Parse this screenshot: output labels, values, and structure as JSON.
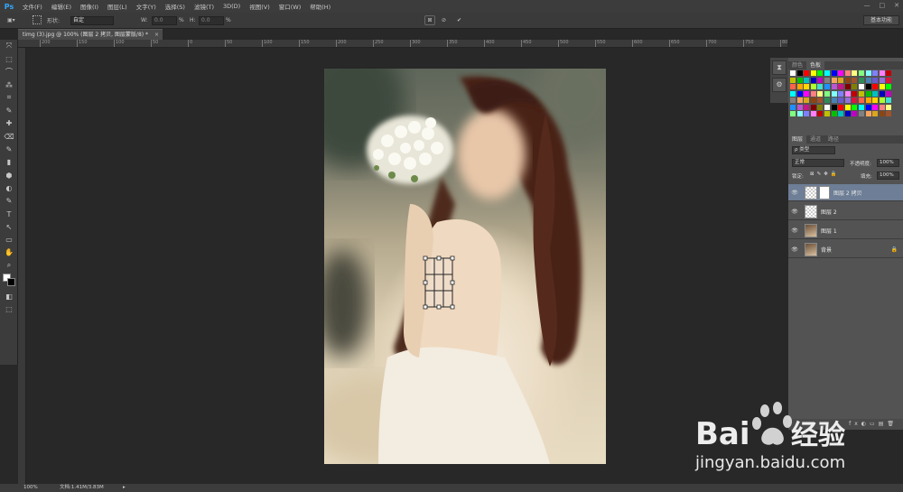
{
  "app": {
    "logo": "Ps"
  },
  "menus": [
    "文件(F)",
    "编辑(E)",
    "图像(I)",
    "图层(L)",
    "文字(Y)",
    "选择(S)",
    "滤镜(T)",
    "3D(D)",
    "视图(V)",
    "窗口(W)",
    "帮助(H)"
  ],
  "window_controls": [
    "—",
    "□",
    "✕"
  ],
  "options": {
    "shape_label": "形状:",
    "shape_value": "自定",
    "w_label": "W:",
    "w_value": "0.0",
    "h_label": "H:",
    "h_value": "0.0",
    "pct": "%",
    "workspace": "基本功能",
    "confirm": "✔",
    "cancel": "⊘"
  },
  "document": {
    "tab_title": "timg (3).jpg @ 100% (图层 2 拷贝, 图层蒙版/8) *",
    "close": "×"
  },
  "ruler_labels": [
    "200",
    "150",
    "100",
    "50",
    "0",
    "50",
    "100",
    "150",
    "200",
    "250",
    "300",
    "350",
    "400",
    "450",
    "500",
    "550",
    "600",
    "650",
    "700",
    "750",
    "800"
  ],
  "tools": [
    "⤧",
    "⬚",
    "⌒",
    "⁂",
    "⌗",
    "✎",
    "✚",
    "⌫",
    "✎",
    "▮",
    "⬢",
    "◐",
    "✎",
    "T",
    "↖",
    "▭",
    "✋",
    "⌕",
    "◧",
    "⬚"
  ],
  "statusbar": {
    "zoom": "100%",
    "doc": "文档:1.41M/3.83M"
  },
  "panels": {
    "top_tabs": [
      "颜色",
      "色板"
    ],
    "layer_tabs": [
      "图层",
      "通道",
      "路径"
    ],
    "kind": "ρ 类型",
    "blend_mode": "正常",
    "opacity_label": "不透明度:",
    "opacity": "100%",
    "lock_label": "锁定:",
    "fill_label": "填充:",
    "fill": "100%",
    "layers": [
      {
        "name": "图层 2 拷贝",
        "selected": true,
        "mask": true,
        "photo": false,
        "locked": false
      },
      {
        "name": "图层 2",
        "selected": false,
        "mask": false,
        "photo": false,
        "locked": false
      },
      {
        "name": "图层 1",
        "selected": false,
        "mask": false,
        "photo": true,
        "locked": false
      },
      {
        "name": "背景",
        "selected": false,
        "mask": false,
        "photo": true,
        "locked": true
      }
    ],
    "swatch_colors": [
      "#ffffff",
      "#000000",
      "#ff0000",
      "#ffff00",
      "#00ff00",
      "#00ffff",
      "#0000ff",
      "#ff00ff",
      "#ff8080",
      "#ffff80",
      "#80ff80",
      "#80ffff",
      "#8080ff",
      "#ff80ff",
      "#c00000",
      "#c0c000",
      "#00c000",
      "#00c0c0",
      "#0000c0",
      "#c000c0",
      "#808080",
      "#f4a460",
      "#daa520",
      "#8b4513",
      "#a0522d",
      "#2e8b57",
      "#4682b4",
      "#6a5acd",
      "#9370db",
      "#dc143c",
      "#ff6347",
      "#ffa500",
      "#ffd700",
      "#adff2f",
      "#40e0d0",
      "#1e90ff",
      "#ba55d3",
      "#c71585",
      "#800000",
      "#808000"
    ]
  },
  "watermark": {
    "brand": "Bai",
    "brand_cn": "经验",
    "url": "jingyan.baidu.com"
  }
}
